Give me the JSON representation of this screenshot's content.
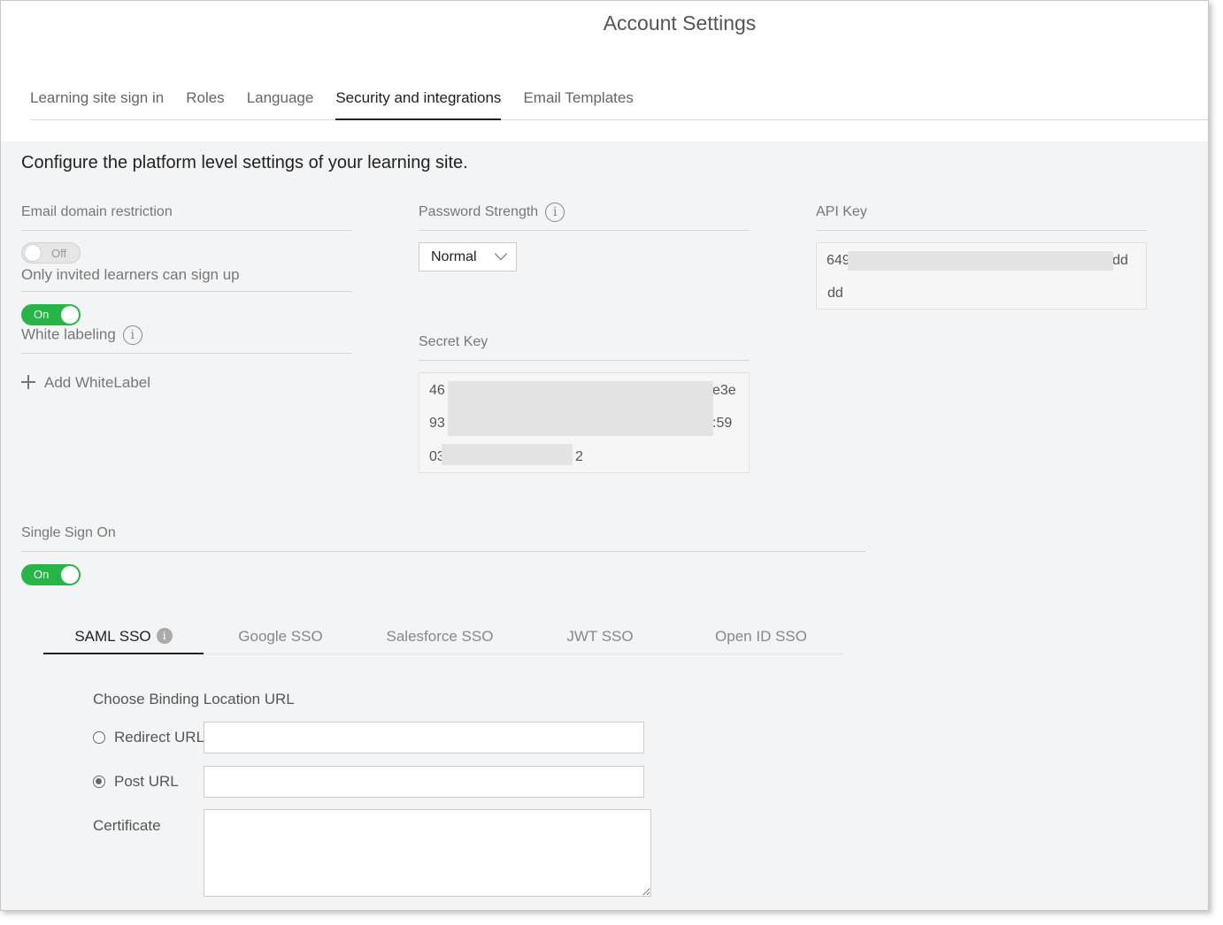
{
  "page": {
    "title": "Account Settings"
  },
  "tabs": [
    {
      "label": "Learning site sign in",
      "active": false
    },
    {
      "label": "Roles",
      "active": false
    },
    {
      "label": "Language",
      "active": false
    },
    {
      "label": "Security and integrations",
      "active": true
    },
    {
      "label": "Email Templates",
      "active": false
    }
  ],
  "intro": "Configure the platform level settings of your learning site.",
  "email_domain": {
    "label": "Email domain restriction",
    "toggle": "Off",
    "description": "Only invited learners can sign up"
  },
  "white_labeling": {
    "toggle": "On",
    "label": "White labeling",
    "info_icon": "i",
    "add_label": "Add WhiteLabel"
  },
  "password_strength": {
    "label": "Password Strength",
    "info_icon": "i",
    "selected": "Normal"
  },
  "secret_key": {
    "label": "Secret Key",
    "lines": [
      {
        "start": "46",
        "end": "e3e"
      },
      {
        "start": "93",
        "end": ":59"
      },
      {
        "start": "03",
        "end": "2"
      }
    ]
  },
  "api_key": {
    "label": "API Key",
    "lines": [
      {
        "start": "649",
        "end": "dd"
      },
      {
        "start": "dd",
        "end": ""
      }
    ]
  },
  "sso": {
    "label": "Single Sign On",
    "toggle": "On",
    "tabs": [
      {
        "label": "SAML SSO",
        "active": true
      },
      {
        "label": "Google SSO",
        "active": false
      },
      {
        "label": "Salesforce SSO",
        "active": false
      },
      {
        "label": "JWT SSO",
        "active": false
      },
      {
        "label": "Open ID SSO",
        "active": false
      }
    ],
    "saml_info_icon": "i",
    "binding_label": "Choose Binding Location URL",
    "redirect_label": "Redirect URL",
    "redirect_value": "",
    "post_label": "Post URL",
    "post_value": "",
    "certificate_label": "Certificate",
    "certificate_value": "",
    "selected_binding": "Post URL"
  },
  "colors": {
    "toggle_on": "#28b446",
    "background": "#f3f4f5"
  },
  "icons": [
    "info-icon",
    "plus-icon",
    "chevron-down-icon",
    "radio-icon"
  ]
}
